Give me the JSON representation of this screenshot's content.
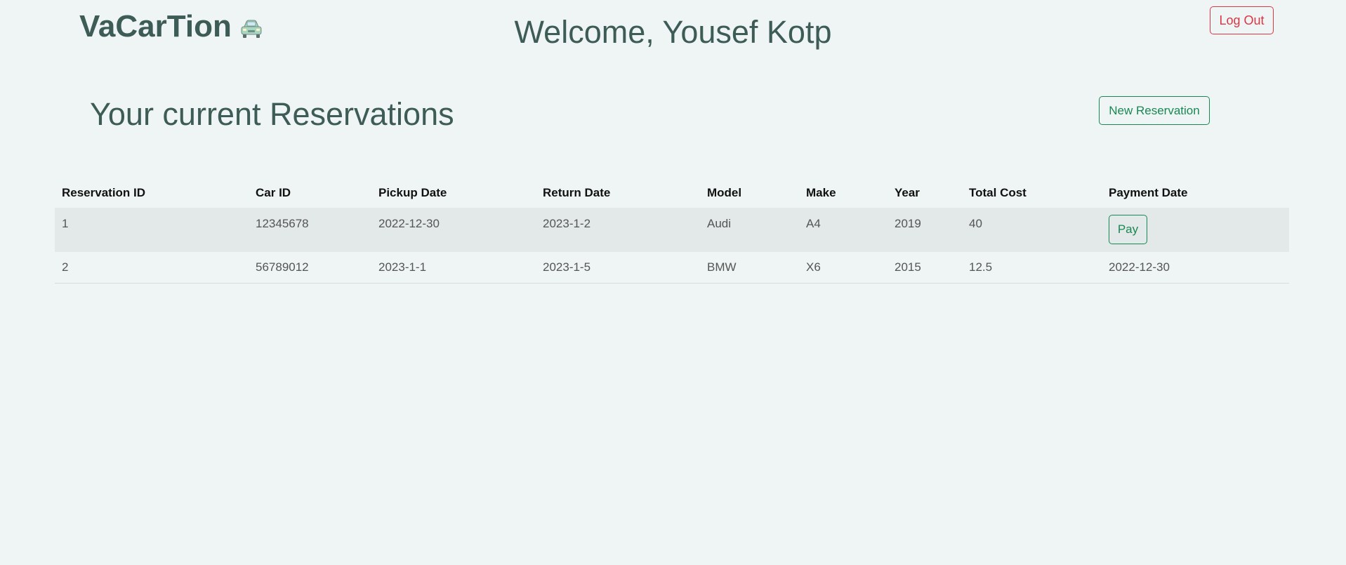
{
  "header": {
    "brand": "VaCarTion",
    "brand_icon": "car-icon",
    "welcome": "Welcome, Yousef Kotp",
    "logout_label": "Log Out"
  },
  "main": {
    "section_title": "Your current Reservations",
    "new_reservation_label": "New Reservation"
  },
  "table": {
    "columns": [
      "Reservation ID",
      "Car ID",
      "Pickup Date",
      "Return Date",
      "Model",
      "Make",
      "Year",
      "Total Cost",
      "Payment Date"
    ],
    "rows": [
      {
        "reservation_id": "1",
        "car_id": "12345678",
        "pickup_date": "2022-12-30",
        "return_date": "2023-1-2",
        "model": "Audi",
        "make": "A4",
        "year": "2019",
        "total_cost": "40",
        "payment_action": "Pay"
      },
      {
        "reservation_id": "2",
        "car_id": "56789012",
        "pickup_date": "2023-1-1",
        "return_date": "2023-1-5",
        "model": "BMW",
        "make": "X6",
        "year": "2015",
        "total_cost": "12.5",
        "payment_date": "2022-12-30"
      }
    ]
  },
  "colors": {
    "background": "#eff5f4",
    "text": "#3e5c56",
    "danger": "#dc3545",
    "success": "#198754"
  }
}
